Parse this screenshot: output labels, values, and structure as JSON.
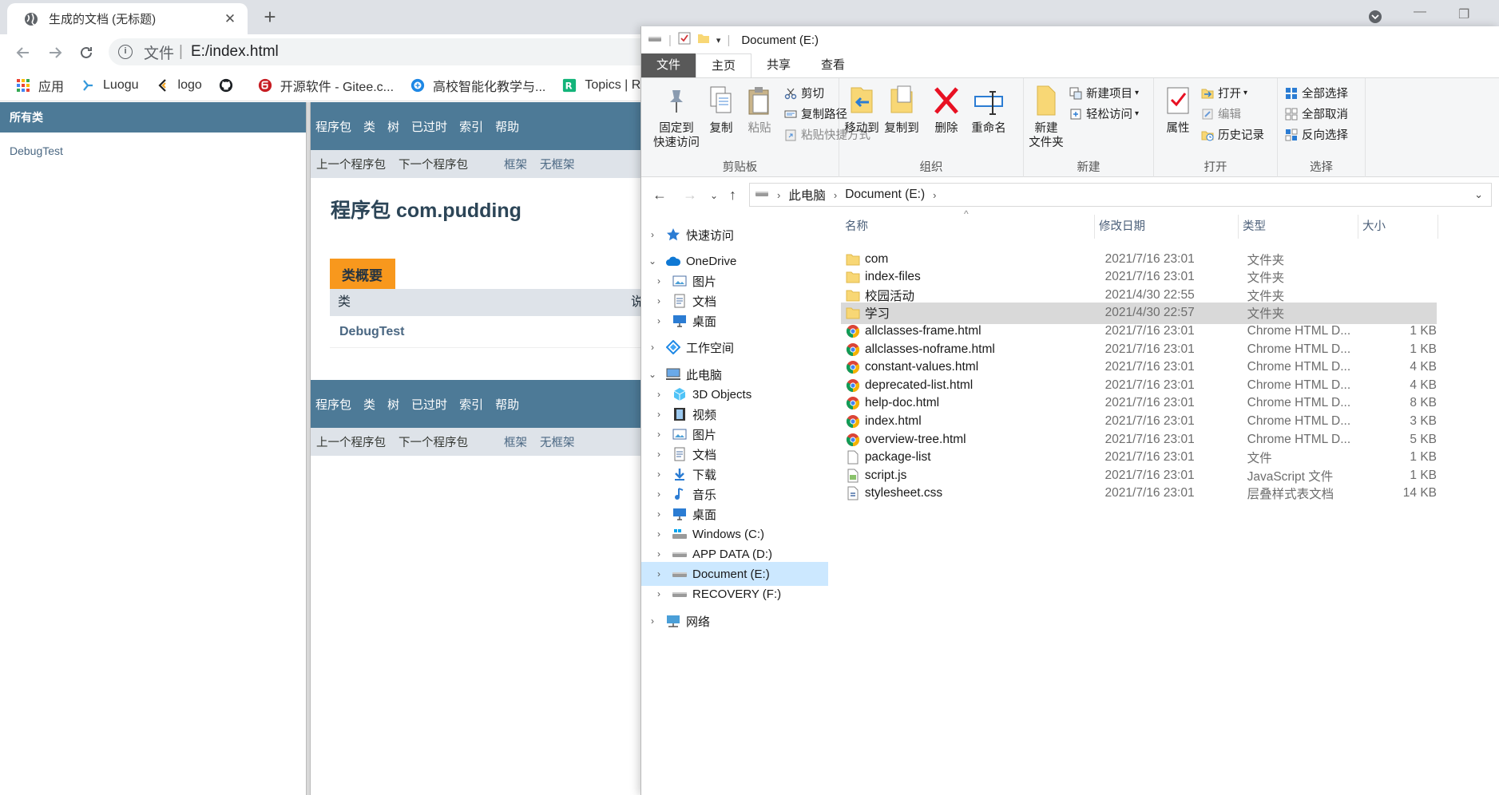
{
  "browser": {
    "tab_title": "生成的文档 (无标题)",
    "tab_close": "✕",
    "new_tab": "+",
    "url_scheme": "文件",
    "url": "E:/index.html",
    "bookmarks": [
      {
        "label": "应用",
        "icon": "apps-grid-icon"
      },
      {
        "label": "Luogu",
        "icon": "luogu-icon"
      },
      {
        "label": "logo",
        "icon": "logo-icon"
      },
      {
        "label": "",
        "icon": "github-icon"
      },
      {
        "label": "开源软件 - Gitee.c...",
        "icon": "gitee-icon"
      },
      {
        "label": "高校智能化教学与...",
        "icon": "education-icon"
      },
      {
        "label": "Topics | Res",
        "icon": "topics-icon"
      }
    ]
  },
  "javadoc": {
    "all_classes": "所有类",
    "class_list": [
      "DebugTest"
    ],
    "nav_links": [
      "程序包",
      "类",
      "树",
      "已过时",
      "索引",
      "帮助"
    ],
    "sub_links": [
      "上一个程序包",
      "下一个程序包",
      "框架",
      "无框架"
    ],
    "package_title": "程序包 com.pudding",
    "summary_caption": "类概要",
    "summary_col1": "类",
    "summary_col2": "说",
    "summary_rows": [
      "DebugTest"
    ]
  },
  "explorer": {
    "title": "Document (E:)",
    "tabs": [
      "文件",
      "主页",
      "共享",
      "查看"
    ],
    "ribbon": {
      "clipboard": {
        "name": "剪贴板",
        "pin": "固定到\n快速访问",
        "copy": "复制",
        "paste": "粘贴",
        "cut": "剪切",
        "copy_path": "复制路径",
        "paste_shortcut": "粘贴快捷方式"
      },
      "organize": {
        "name": "组织",
        "move_to": "移动到",
        "copy_to": "复制到",
        "delete": "删除",
        "rename": "重命名"
      },
      "new": {
        "name": "新建",
        "new_folder": "新建\n文件夹",
        "new_item": "新建项目",
        "easy_access": "轻松访问"
      },
      "open": {
        "name": "打开",
        "properties": "属性",
        "open": "打开",
        "edit": "编辑",
        "history": "历史记录"
      },
      "select": {
        "name": "选择",
        "select_all": "全部选择",
        "select_none": "全部取消",
        "invert": "反向选择"
      }
    },
    "breadcrumb": [
      "此电脑",
      "Document (E:)"
    ],
    "nav": [
      {
        "label": "快速访问",
        "icon": "star-icon",
        "level": 0,
        "arrow": "›"
      },
      {
        "label": "OneDrive",
        "icon": "cloud-icon",
        "level": 0,
        "arrow": "⌄"
      },
      {
        "label": "图片",
        "icon": "pictures-icon",
        "level": 1,
        "arrow": "›"
      },
      {
        "label": "文档",
        "icon": "documents-icon",
        "level": 1,
        "arrow": "›"
      },
      {
        "label": "桌面",
        "icon": "desktop-icon",
        "level": 1,
        "arrow": "›"
      },
      {
        "label": "工作空间",
        "icon": "workspace-icon",
        "level": 0,
        "arrow": "›"
      },
      {
        "label": "此电脑",
        "icon": "computer-icon",
        "level": 0,
        "arrow": "⌄"
      },
      {
        "label": "3D Objects",
        "icon": "cube-icon",
        "level": 1,
        "arrow": "›"
      },
      {
        "label": "视频",
        "icon": "video-icon",
        "level": 1,
        "arrow": "›"
      },
      {
        "label": "图片",
        "icon": "pictures-icon",
        "level": 1,
        "arrow": "›"
      },
      {
        "label": "文档",
        "icon": "documents-icon",
        "level": 1,
        "arrow": "›"
      },
      {
        "label": "下载",
        "icon": "download-icon",
        "level": 1,
        "arrow": "›"
      },
      {
        "label": "音乐",
        "icon": "music-icon",
        "level": 1,
        "arrow": "›"
      },
      {
        "label": "桌面",
        "icon": "desktop-icon",
        "level": 1,
        "arrow": "›"
      },
      {
        "label": "Windows (C:)",
        "icon": "drive-windows-icon",
        "level": 1,
        "arrow": "›"
      },
      {
        "label": "APP DATA (D:)",
        "icon": "drive-icon",
        "level": 1,
        "arrow": "›"
      },
      {
        "label": "Document (E:)",
        "icon": "drive-icon",
        "level": 1,
        "arrow": "›"
      },
      {
        "label": "RECOVERY (F:)",
        "icon": "drive-icon",
        "level": 1,
        "arrow": "›"
      },
      {
        "label": "网络",
        "icon": "network-icon",
        "level": 0,
        "arrow": "›"
      }
    ],
    "columns": [
      "名称",
      "修改日期",
      "类型",
      "大小"
    ],
    "files": [
      {
        "name": "com",
        "date": "2021/7/16 23:01",
        "type": "文件夹",
        "size": "",
        "icon": "folder-icon"
      },
      {
        "name": "index-files",
        "date": "2021/7/16 23:01",
        "type": "文件夹",
        "size": "",
        "icon": "folder-icon"
      },
      {
        "name": "校园活动",
        "date": "2021/4/30 22:55",
        "type": "文件夹",
        "size": "",
        "icon": "folder-icon"
      },
      {
        "name": "学习",
        "date": "2021/4/30 22:57",
        "type": "文件夹",
        "size": "",
        "icon": "folder-icon"
      },
      {
        "name": "allclasses-frame.html",
        "date": "2021/7/16 23:01",
        "type": "Chrome HTML D...",
        "size": "1 KB",
        "icon": "chrome-icon"
      },
      {
        "name": "allclasses-noframe.html",
        "date": "2021/7/16 23:01",
        "type": "Chrome HTML D...",
        "size": "1 KB",
        "icon": "chrome-icon"
      },
      {
        "name": "constant-values.html",
        "date": "2021/7/16 23:01",
        "type": "Chrome HTML D...",
        "size": "4 KB",
        "icon": "chrome-icon"
      },
      {
        "name": "deprecated-list.html",
        "date": "2021/7/16 23:01",
        "type": "Chrome HTML D...",
        "size": "4 KB",
        "icon": "chrome-icon"
      },
      {
        "name": "help-doc.html",
        "date": "2021/7/16 23:01",
        "type": "Chrome HTML D...",
        "size": "8 KB",
        "icon": "chrome-icon"
      },
      {
        "name": "index.html",
        "date": "2021/7/16 23:01",
        "type": "Chrome HTML D...",
        "size": "3 KB",
        "icon": "chrome-icon"
      },
      {
        "name": "overview-tree.html",
        "date": "2021/7/16 23:01",
        "type": "Chrome HTML D...",
        "size": "5 KB",
        "icon": "chrome-icon"
      },
      {
        "name": "package-list",
        "date": "2021/7/16 23:01",
        "type": "文件",
        "size": "1 KB",
        "icon": "file-icon"
      },
      {
        "name": "script.js",
        "date": "2021/7/16 23:01",
        "type": "JavaScript 文件",
        "size": "1 KB",
        "icon": "script-icon"
      },
      {
        "name": "stylesheet.css",
        "date": "2021/7/16 23:01",
        "type": "层叠样式表文档",
        "size": "14 KB",
        "icon": "css-icon"
      }
    ]
  }
}
